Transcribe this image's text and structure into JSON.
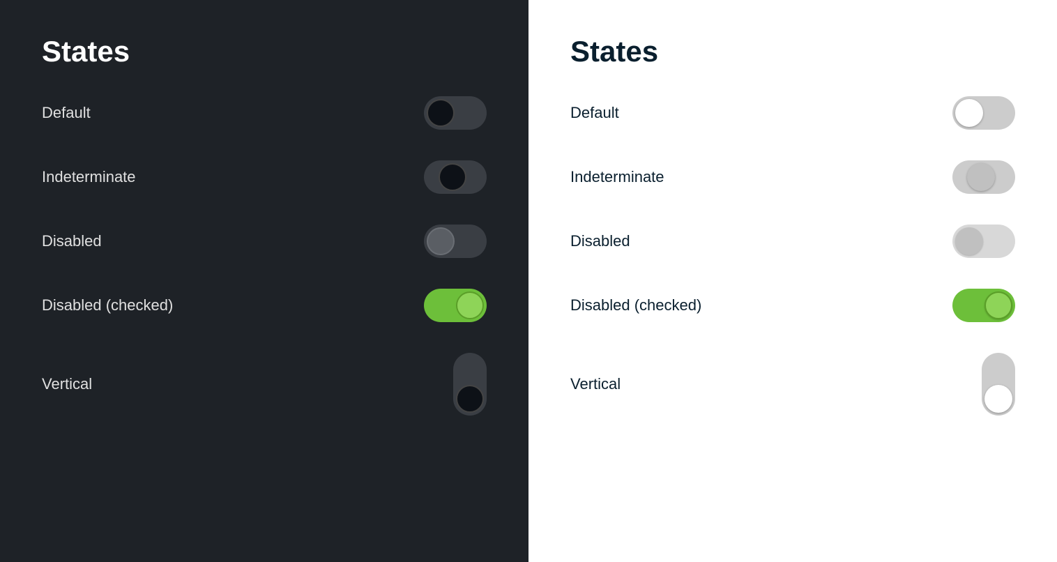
{
  "dark_panel": {
    "title": "States",
    "states": [
      {
        "label": "Default",
        "id": "dark-default"
      },
      {
        "label": "Indeterminate",
        "id": "dark-indeterminate"
      },
      {
        "label": "Disabled",
        "id": "dark-disabled"
      },
      {
        "label": "Disabled (checked)",
        "id": "dark-disabled-checked"
      },
      {
        "label": "Vertical",
        "id": "dark-vertical"
      }
    ]
  },
  "light_panel": {
    "title": "States",
    "states": [
      {
        "label": "Default",
        "id": "light-default"
      },
      {
        "label": "Indeterminate",
        "id": "light-indeterminate"
      },
      {
        "label": "Disabled",
        "id": "light-disabled"
      },
      {
        "label": "Disabled (checked)",
        "id": "light-disabled-checked"
      },
      {
        "label": "Vertical",
        "id": "light-vertical"
      }
    ]
  }
}
